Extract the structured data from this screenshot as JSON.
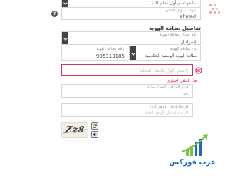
{
  "top": {
    "question_partial": "ما هو اسم أول معلم لك؟",
    "answer_label": "جواب سؤال الأمان",
    "answer_value": "ahmad",
    "help_symbol": "?"
  },
  "identity": {
    "section_title": "تفاصيل بطاقة الهوية",
    "country_label": "بلد إصدار بطاقة الهوية",
    "country_value": "إسرائيل",
    "card_type_label": "نوع بطاقة الهوية",
    "card_type_value": "بطاقة الهوية الوطنية الحكومية",
    "card_number_label": "رقم بطاقة الهوية",
    "card_number_value": "905313185",
    "name_placeholder": "الاسم الأول باللغة المحلية",
    "name_error_icon": "x-circle-icon",
    "error_text": "هذا الحقل إجباري",
    "family_name_label": "اسم العائلة باللغة المحلية",
    "family_name_value": "حمد",
    "captcha_label": "الرجاء إدخال الرمز أدناه",
    "captcha_placeholder": "الرجاء إدخال الرمز أعلاه",
    "captcha_text": "Zz8"
  },
  "logo": {
    "text": "عرب فوركس",
    "colors": {
      "green": "#7dc242",
      "blue": "#1c6db7"
    }
  },
  "colors": {
    "error": "#d9315a",
    "accent_dots": "#e8a0a0"
  }
}
